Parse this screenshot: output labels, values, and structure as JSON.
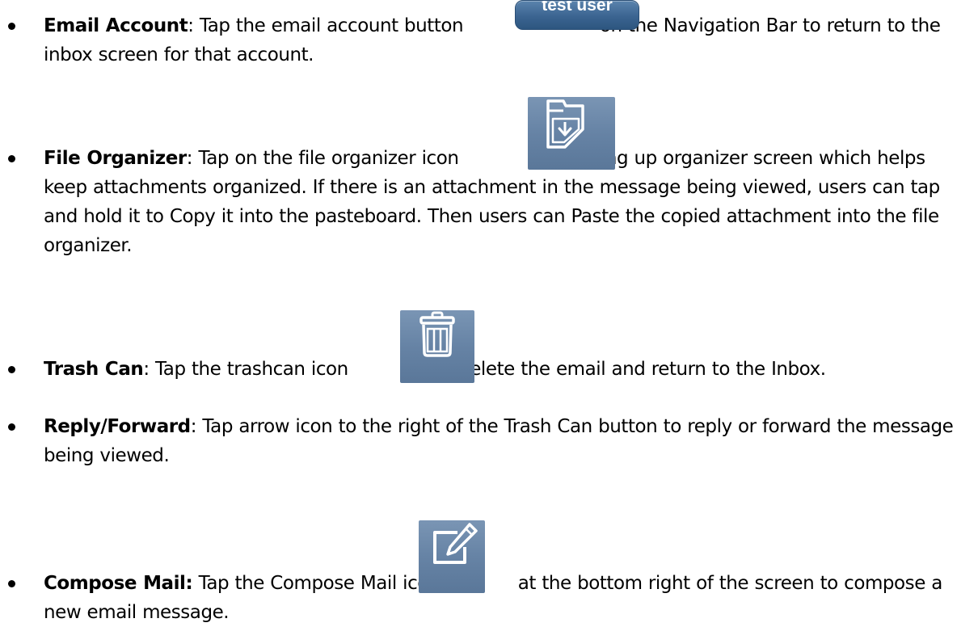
{
  "items": [
    {
      "title": "Email Account",
      "sep": ":",
      "t1": " Tap the email account button ",
      "icon_label": "test user",
      "icon_name": "email-account-button",
      "t2": " on the Navigation Bar to return to the inbox screen for that account."
    },
    {
      "title": "File Organizer",
      "sep": ":",
      "t1": " Tap on the file organizer icon ",
      "icon_name": "file-organizer-icon",
      "t2": " to bring up organizer screen which helps keep attachments organized. If there is an attachment in the message being viewed, users can tap and hold it to Copy it into the pasteboard. Then users can Paste the copied attachment into the file organizer."
    },
    {
      "title": "Trash Can",
      "sep": ":",
      "t1": " Tap the trashcan icon ",
      "icon_name": "trash-icon",
      "t2": " to delete the email and return to the Inbox."
    },
    {
      "title": "Reply/Forward",
      "sep": ":",
      "t1": " Tap arrow icon to the right of the Trash Can button to reply or forward the message being viewed."
    },
    {
      "title": "Compose Mail:",
      "t1": " Tap the Compose Mail icon ",
      "icon_name": "compose-icon",
      "t2": " at the bottom right of the screen to compose a new email message."
    }
  ],
  "colors": {
    "text": "#000000",
    "icon_tile": "#6683a5",
    "email_button": "#3b6491"
  }
}
